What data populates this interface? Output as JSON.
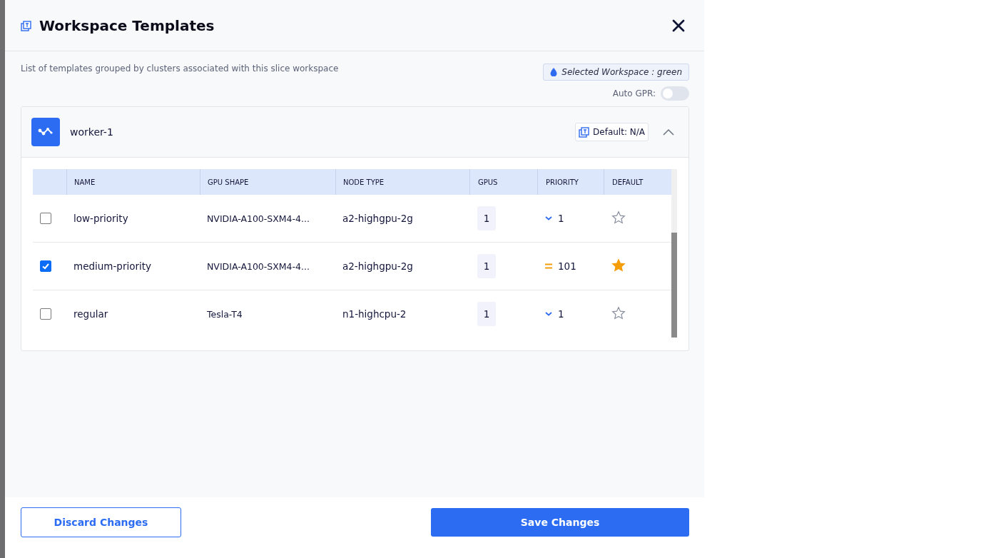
{
  "dialog": {
    "title": "Workspace Templates",
    "description": "List of templates grouped by clusters associated with this slice workspace",
    "selected_workspace": {
      "label": "Selected Workspace :",
      "value": "green"
    },
    "auto_gpr": {
      "label": "Auto GPR:",
      "on": false
    }
  },
  "cluster": {
    "name": "worker-1",
    "default_label": "Default: N/A",
    "expanded": true,
    "table": {
      "columns": [
        "NAME",
        "GPU SHAPE",
        "NODE TYPE",
        "GPUS",
        "PRIORITY",
        "DEFAULT"
      ],
      "rows": [
        {
          "checked": false,
          "name": "low-priority",
          "gpu_shape": "NVIDIA-A100-SXM4-4...",
          "node_type": "a2-highgpu-2g",
          "gpus": "1",
          "kind": "low",
          "priority": "1",
          "default": false
        },
        {
          "checked": true,
          "name": "medium-priority",
          "gpu_shape": "NVIDIA-A100-SXM4-4...",
          "node_type": "a2-highgpu-2g",
          "gpus": "1",
          "kind": "medium",
          "priority": "101",
          "default": true
        },
        {
          "checked": false,
          "name": "regular",
          "gpu_shape": "Tesla-T4",
          "node_type": "n1-highcpu-2",
          "gpus": "1",
          "kind": "low",
          "priority": "1",
          "default": false
        }
      ]
    }
  },
  "footer": {
    "discard": "Discard Changes",
    "save": "Save Changes"
  }
}
